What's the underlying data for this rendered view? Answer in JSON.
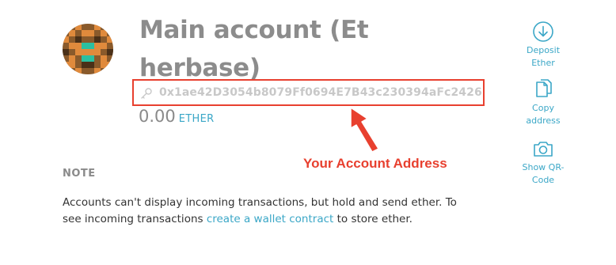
{
  "account": {
    "title": "Main account (Etherbase)",
    "address": "0x1ae42D3054b8079Ff0694E7B43c230394aFc2426",
    "balance_amount": "0.00",
    "balance_unit": "ETHER"
  },
  "annotation": {
    "callout": "Your Account Address",
    "color": "#e8402f"
  },
  "note": {
    "label": "NOTE",
    "text_before": "Accounts can't display incoming transactions, but hold and send ether. To see incoming transactions ",
    "link": "create a wallet contract",
    "text_after": " to store ether."
  },
  "actions": [
    {
      "icon": "download-circle-icon",
      "line1": "Deposit",
      "line2": "Ether"
    },
    {
      "icon": "copy-icon",
      "line1": "Copy",
      "line2": "address"
    },
    {
      "icon": "camera-icon",
      "line1": "Show QR-",
      "line2": "Code"
    }
  ],
  "colors": {
    "accent": "#3ba7c7",
    "title": "#8c8c8c",
    "address": "#c8c8c8"
  }
}
